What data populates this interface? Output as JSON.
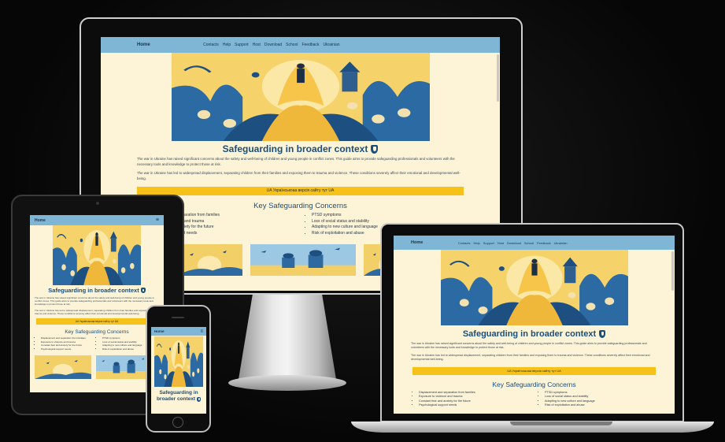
{
  "site": {
    "brand": "Home",
    "nav_links": [
      "Contacts",
      "Help",
      "Support",
      "Host",
      "Download",
      "School",
      "Feedback",
      "Ukrainian"
    ],
    "title": "Safeguarding in broader context",
    "para1": "The war in Ukraine has raised significant concerns about the safety and well-being of children and young people in conflict zones. This guide aims to provide safeguarding professionals and volunteers with the necessary tools and knowledge to protect those at risk.",
    "para2": "The war in Ukraine has led to widespread displacement, separating children from their families and exposing them to trauma and violence. These conditions severely affect their emotional and developmental well-being.",
    "ua_button": "UA Українськоаа версія сайту тут UA",
    "concerns_title": "Key Safeguarding Concerns",
    "concerns_left": [
      "Displacement and separation from families",
      "Exposure to violence and trauma",
      "Constant fear and anxiety for the future",
      "Psychological support needs"
    ],
    "concerns_right": [
      "PTSD symptoms",
      "Loss of social status and stability",
      "Adapting to new culture and language",
      "Risk of exploitation and abuse"
    ],
    "imac_left_visible": [
      "aration from families",
      "and trauma",
      "iety for the future",
      "t needs"
    ],
    "phone_title_line1": "Safeguarding in",
    "phone_title_line2": "broader context",
    "menu_icon": "≡"
  },
  "colors": {
    "navbar": "#7fb6d6",
    "page_bg": "#fdf3d6",
    "title": "#1a4f7c",
    "button": "#f6c21a"
  },
  "icons": [
    "shield-icon",
    "hamburger-menu-icon"
  ]
}
